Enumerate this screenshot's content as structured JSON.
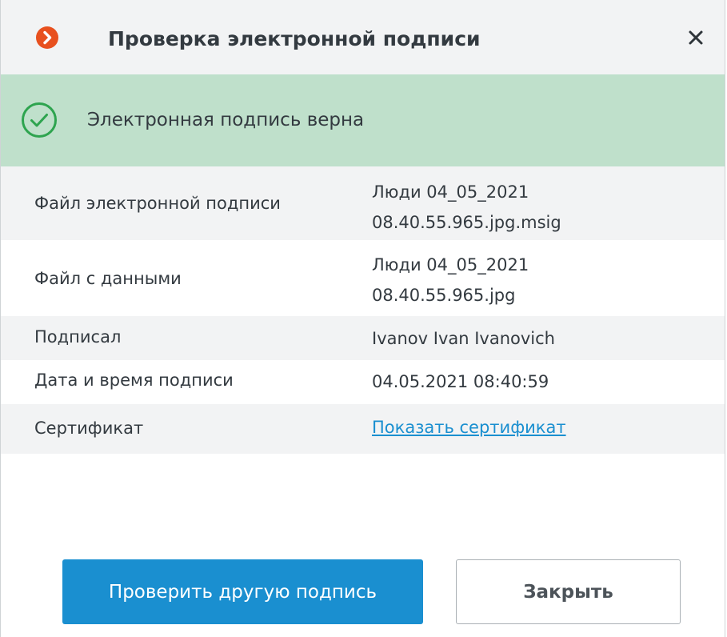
{
  "dialog": {
    "title": "Проверка электронной подписи"
  },
  "status": {
    "text": "Электронная подпись верна",
    "color": "#2ea44f"
  },
  "details": {
    "signature_file_label": "Файл электронной подписи",
    "signature_file_line1": "Люди 04_05_2021",
    "signature_file_line2": "08.40.55.965.jpg.msig",
    "data_file_label": "Файл с данными",
    "data_file_line1": "Люди 04_05_2021",
    "data_file_line2": "08.40.55.965.jpg",
    "signed_by_label": "Подписал",
    "signed_by_value": "Ivanov Ivan Ivanovich",
    "datetime_label": "Дата и время подписи",
    "datetime_value": "04.05.2021 08:40:59",
    "certificate_label": "Сертификат",
    "certificate_link": "Показать сертификат"
  },
  "buttons": {
    "verify_another": "Проверить другую подпись",
    "close": "Закрыть"
  },
  "colors": {
    "accent": "#1a8fd0",
    "brand": "#e8501e",
    "banner": "#bfe0cb"
  },
  "icons": {
    "logo": "app-logo-icon",
    "close": "close-icon",
    "status": "check-circle-icon"
  }
}
